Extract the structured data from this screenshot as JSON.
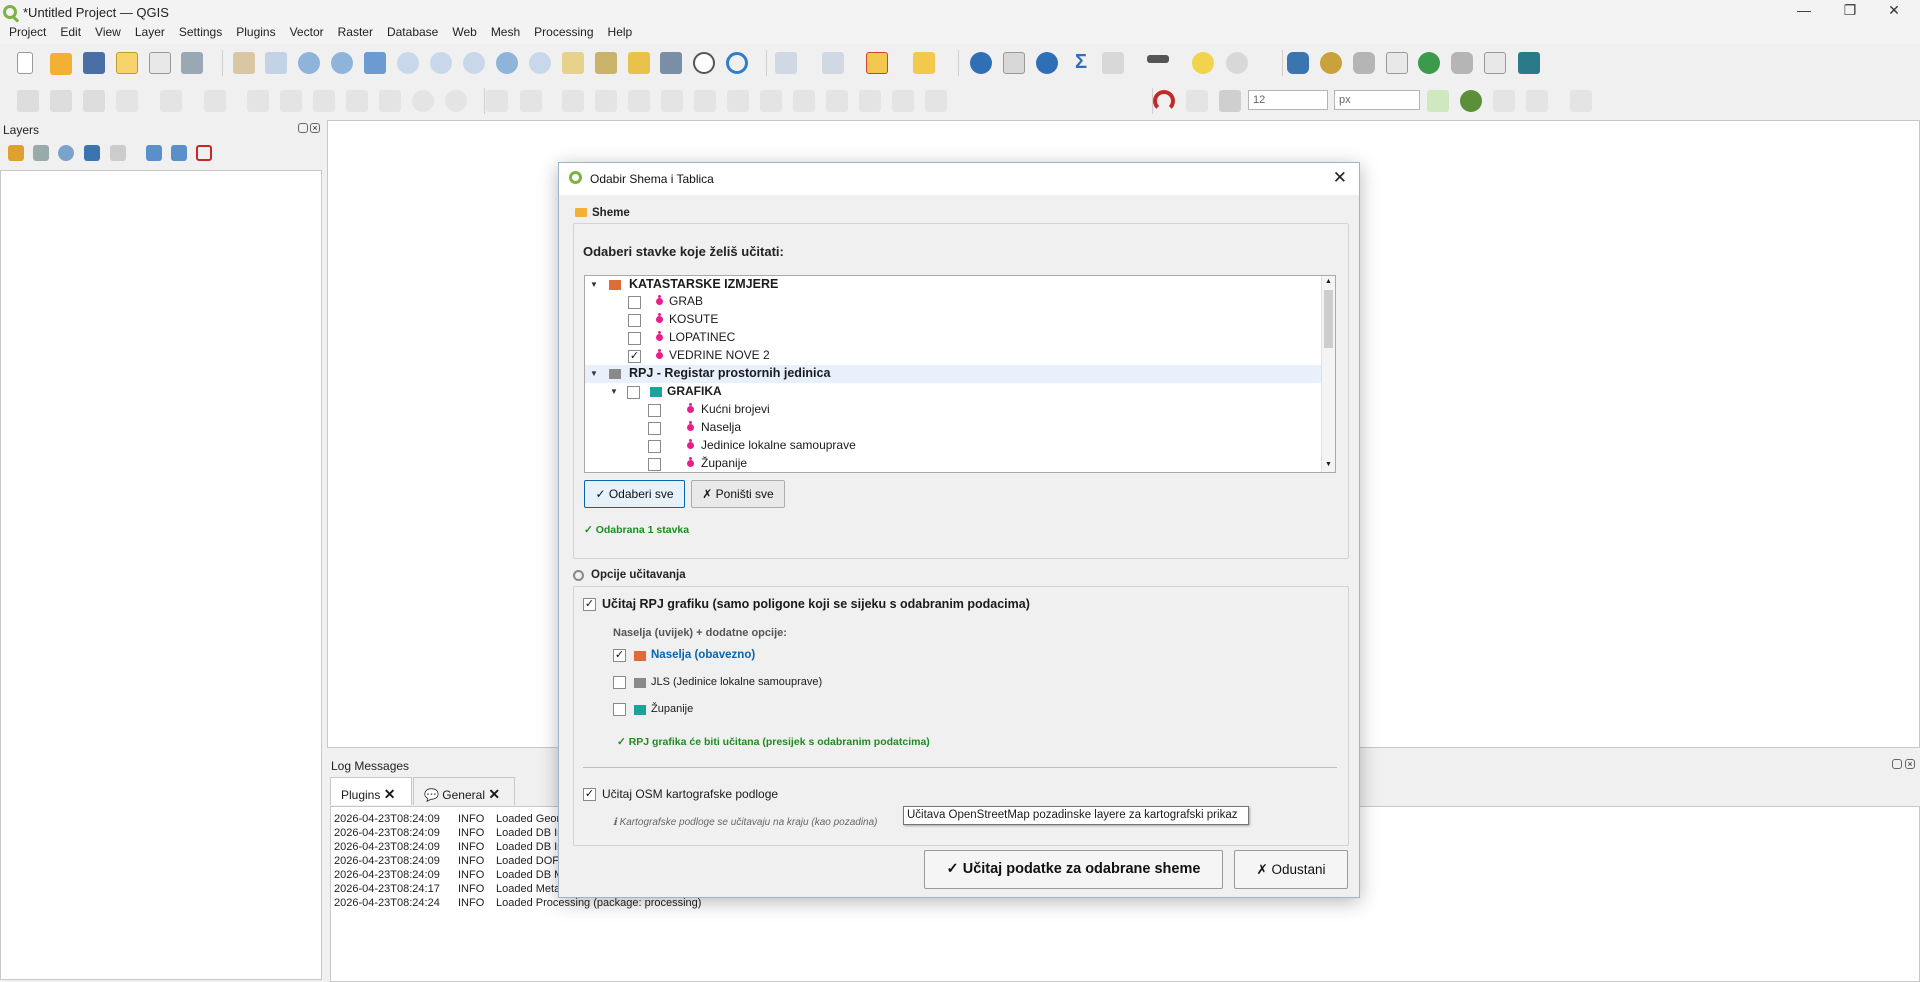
{
  "window": {
    "title": "*Untitled Project — QGIS"
  },
  "menu": [
    "Project",
    "Edit",
    "View",
    "Layer",
    "Settings",
    "Plugins",
    "Vector",
    "Raster",
    "Database",
    "Web",
    "Mesh",
    "Processing",
    "Help"
  ],
  "toolbar": {
    "size_value": "12",
    "unit_value": "px"
  },
  "layers_panel": {
    "title": "Layers"
  },
  "log": {
    "title": "Log Messages",
    "tabs": [
      "Plugins",
      "General"
    ],
    "lines": [
      {
        "time": "2026-04-23T08:24:09",
        "level": "INFO",
        "msg": "Loaded Geom"
      },
      {
        "time": "2026-04-23T08:24:09",
        "level": "INFO",
        "msg": "Loaded DB In"
      },
      {
        "time": "2026-04-23T08:24:09",
        "level": "INFO",
        "msg": "Loaded DB In"
      },
      {
        "time": "2026-04-23T08:24:09",
        "level": "INFO",
        "msg": "Loaded DOF"
      },
      {
        "time": "2026-04-23T08:24:09",
        "level": "INFO",
        "msg": "Loaded DB M"
      },
      {
        "time": "2026-04-23T08:24:17",
        "level": "INFO",
        "msg": "Loaded Meta"
      },
      {
        "time": "2026-04-23T08:24:24",
        "level": "INFO",
        "msg": "Loaded Processing (package: processing)"
      }
    ]
  },
  "dialog": {
    "title": "Odabir Shema i Tablica",
    "schemes_label": "Sheme",
    "select_prompt": "Odaberi stavke koje želiš učitati:",
    "tree": {
      "group1": "KATASTARSKE IZMJERE",
      "group1_items": [
        {
          "label": "GRAB",
          "checked": false
        },
        {
          "label": "KOSUTE",
          "checked": false
        },
        {
          "label": "LOPATINEC",
          "checked": false
        },
        {
          "label": "VEDRINE NOVE 2",
          "checked": true
        }
      ],
      "group2": "RPJ - Registar prostornih jedinica",
      "subgroup": "GRAFIKA",
      "subgroup_items": [
        {
          "label": "Kućni brojevi",
          "checked": false
        },
        {
          "label": "Naselja",
          "checked": false
        },
        {
          "label": "Jedinice lokalne samouprave",
          "checked": false
        },
        {
          "label": "Županije",
          "checked": false
        }
      ]
    },
    "select_all": "✓ Odaberi sve",
    "deselect_all": "✗ Poništi sve",
    "selected_status": "✓ Odabrana 1 stavka",
    "options_label": "Opcije učitavanja",
    "rpj_option": "Učitaj RPJ grafiku (samo poligone koji se sijeku s odabranim podacima)",
    "naselja_note": "Naselja (uvijek) + dodatne opcije:",
    "opt_naselja": "Naselja (obavezno)",
    "opt_jls": "JLS (Jedinice lokalne samouprave)",
    "opt_zupanije": "Županije",
    "rpj_status": "✓ RPJ grafika će biti učitana (presijek s odabranim podatcima)",
    "osm_option": "Učitaj OSM kartografske podloge",
    "osm_note": "ℹ Kartografske podloge se učitavaju na kraju (kao pozadina)",
    "load_button": "✓ Učitaj podatke za odabrane sheme",
    "cancel_button": "✗ Odustani"
  },
  "tooltip": "Učitava OpenStreetMap pozadinske layere za kartografski prikaz",
  "colors": {
    "accent": "#0a64ad",
    "success": "#1e8c1e",
    "qgis_green": "#7cb342",
    "pink_dot": "#e91e8c"
  }
}
